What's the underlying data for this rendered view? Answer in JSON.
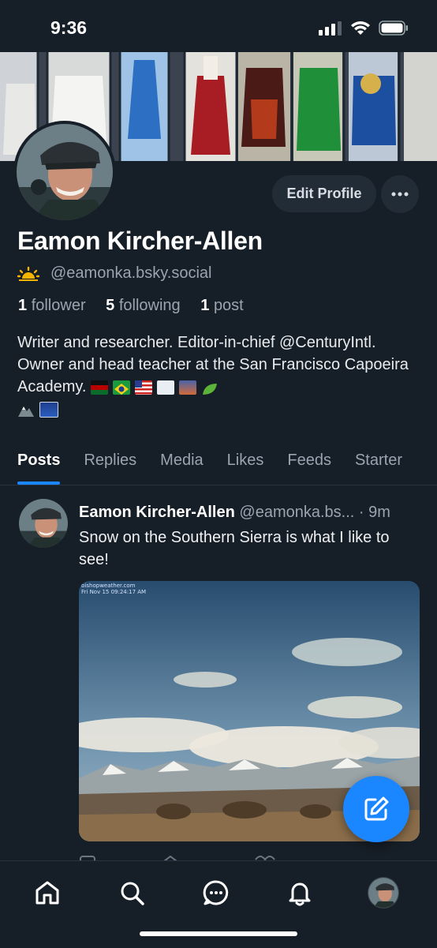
{
  "status": {
    "time": "9:36"
  },
  "profile": {
    "name": "Eamon Kircher-Allen",
    "handle": "@eamonka.bsky.social",
    "edit_label": "Edit Profile",
    "stats": {
      "followers_count": "1",
      "followers_label": "follower",
      "following_count": "5",
      "following_label": "following",
      "posts_count": "1",
      "posts_label": "post"
    },
    "bio": "Writer and researcher. Editor-in-chief @CenturyIntl. Owner and head teacher at the San Francisco Capoeira Academy."
  },
  "tabs": [
    {
      "label": "Posts",
      "active": true
    },
    {
      "label": "Replies"
    },
    {
      "label": "Media"
    },
    {
      "label": "Likes"
    },
    {
      "label": "Feeds"
    },
    {
      "label": "Starter"
    }
  ],
  "post": {
    "author": "Eamon Kircher-Allen",
    "handle": "@eamonka.bs...",
    "time": "· 9m",
    "text": "Snow on the Southern Sierra is what I like to see!",
    "image_caption_1": "bishopweather.com",
    "image_caption_2": "Fri Nov 15 09:24:17 AM"
  },
  "nav": [
    "home-icon",
    "search-icon",
    "chat-icon",
    "bell-icon",
    "profile-avatar"
  ],
  "colors": {
    "accent": "#1a86ff",
    "background": "#161e27",
    "muted": "#9aa5b1"
  }
}
